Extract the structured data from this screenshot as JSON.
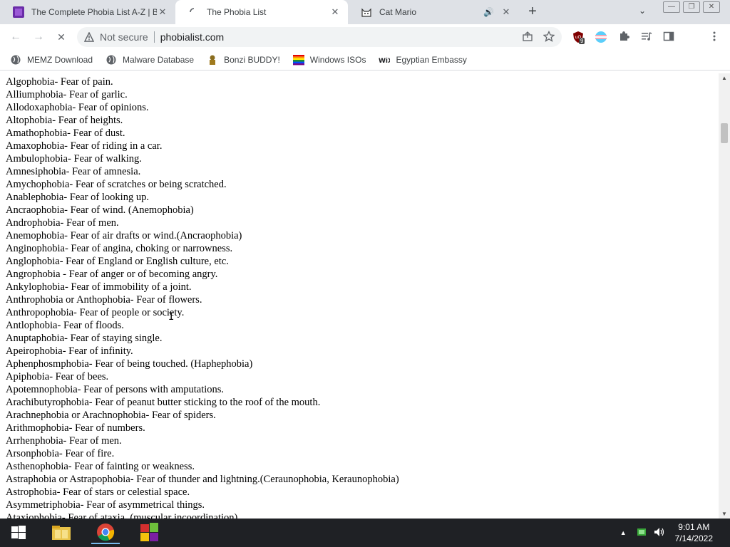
{
  "tabs": [
    {
      "title": "The Complete Phobia List A-Z | B",
      "close": "✕"
    },
    {
      "title": "The Phobia List",
      "close": "✕"
    },
    {
      "title": "Cat Mario",
      "close": "✕",
      "audio": "🔊"
    }
  ],
  "new_tab": "+",
  "tab_search": "⌄",
  "window_buttons": {
    "minimize": "—",
    "restore": "❐",
    "close": "✕"
  },
  "toolbar": {
    "back": "←",
    "forward": "→",
    "reload": "✕",
    "security_label": "Not secure",
    "url": "phobialist.com",
    "ext_badge": "9"
  },
  "bookmarks": [
    {
      "label": "MEMZ Download",
      "icon": "globe-icon"
    },
    {
      "label": "Malware Database",
      "icon": "globe-icon"
    },
    {
      "label": "Bonzi BUDDY!",
      "icon": "bonzi-icon"
    },
    {
      "label": "Windows ISOs",
      "icon": "rainbow-icon"
    },
    {
      "label": "Egyptian Embassy",
      "icon": "wix-icon"
    }
  ],
  "phobias": [
    "Algophobia- Fear of pain.",
    "Alliumphobia- Fear of garlic.",
    "Allodoxaphobia- Fear of opinions.",
    "Altophobia- Fear of heights.",
    "Amathophobia- Fear of dust.",
    "Amaxophobia- Fear of riding in a car.",
    "Ambulophobia- Fear of walking.",
    "Amnesiphobia- Fear of amnesia.",
    "Amychophobia- Fear of scratches or being scratched.",
    "Anablephobia- Fear of looking up.",
    "Ancraophobia- Fear of wind. (Anemophobia)",
    "Androphobia- Fear of men.",
    "Anemophobia- Fear of air drafts or wind.(Ancraophobia)",
    "Anginophobia- Fear of angina, choking or narrowness.",
    "Anglophobia- Fear of England or English culture, etc.",
    "Angrophobia - Fear of anger or of becoming angry.",
    "Ankylophobia- Fear of immobility of a joint.",
    "Anthrophobia or Anthophobia- Fear of flowers.",
    "Anthropophobia- Fear of people or society.",
    "Antlophobia- Fear of floods.",
    "Anuptaphobia- Fear of staying single.",
    "Apeirophobia- Fear of infinity.",
    "Aphenphosmphobia- Fear of being touched. (Haphephobia)",
    "Apiphobia- Fear of bees.",
    "Apotemnophobia- Fear of persons with amputations.",
    "Arachibutyrophobia- Fear of peanut butter sticking to the roof of the mouth.",
    "Arachnephobia or Arachnophobia- Fear of spiders.",
    "Arithmophobia- Fear of numbers.",
    "Arrhenphobia- Fear of men.",
    "Arsonphobia- Fear of fire.",
    "Asthenophobia- Fear of fainting or weakness.",
    "Astraphobia or Astrapophobia- Fear of thunder and lightning.(Ceraunophobia, Keraunophobia)",
    "Astrophobia- Fear of stars or celestial space.",
    "Asymmetriphobia- Fear of asymmetrical things.",
    "Ataxiophobia- Fear of ataxia. (muscular incoordination)"
  ],
  "taskbar": {
    "time": "9:01 AM",
    "date": "7/14/2022",
    "tray_arrow": "▲"
  }
}
